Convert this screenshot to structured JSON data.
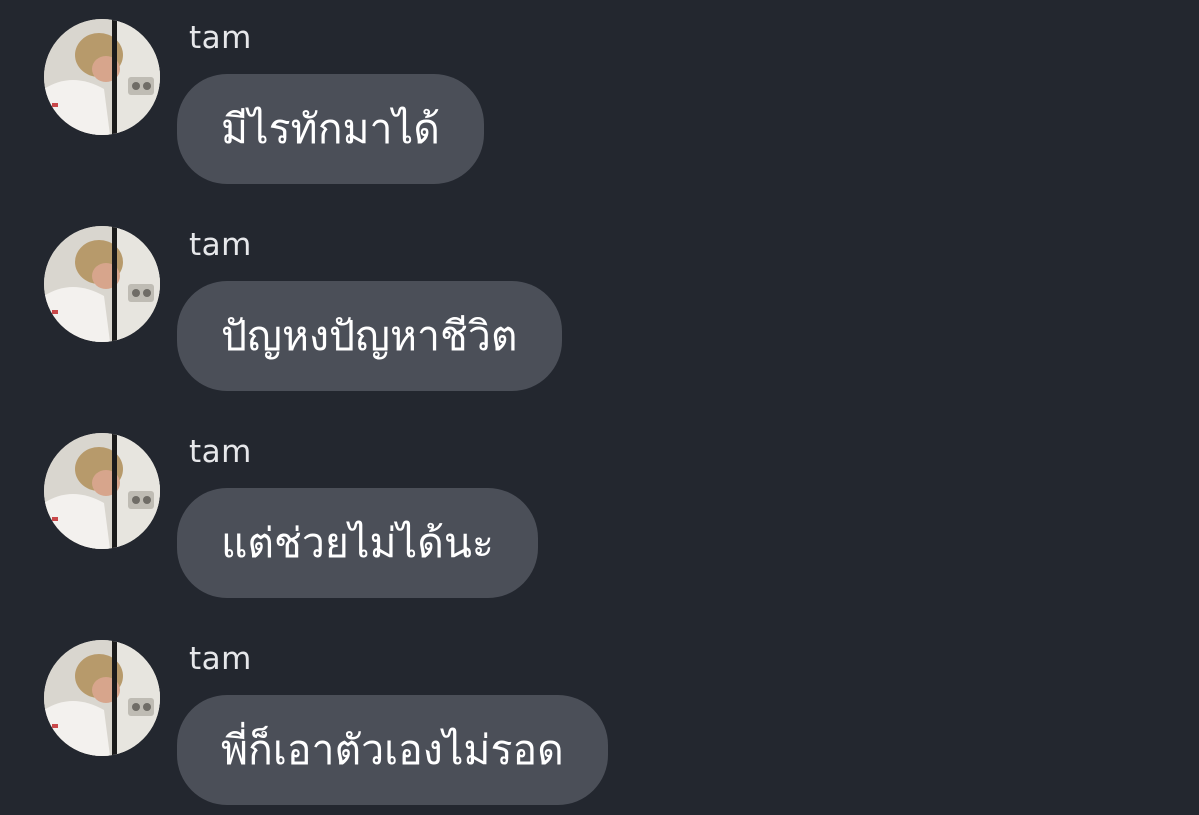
{
  "colors": {
    "background": "#23272f",
    "bubble": "#4b4f58",
    "sender_text": "#e6e7ea",
    "message_text": "#ffffff"
  },
  "messages": [
    {
      "sender": "tam",
      "text": "มีไรทักมาได้",
      "avatar_icon": "user-avatar"
    },
    {
      "sender": "tam",
      "text": "ปัญหงปัญหาชีวิต",
      "avatar_icon": "user-avatar"
    },
    {
      "sender": "tam",
      "text": "แต่ช่วยไม่ได้นะ",
      "avatar_icon": "user-avatar"
    },
    {
      "sender": "tam",
      "text": "พี่ก็เอาตัวเองไม่รอด",
      "avatar_icon": "user-avatar"
    }
  ]
}
